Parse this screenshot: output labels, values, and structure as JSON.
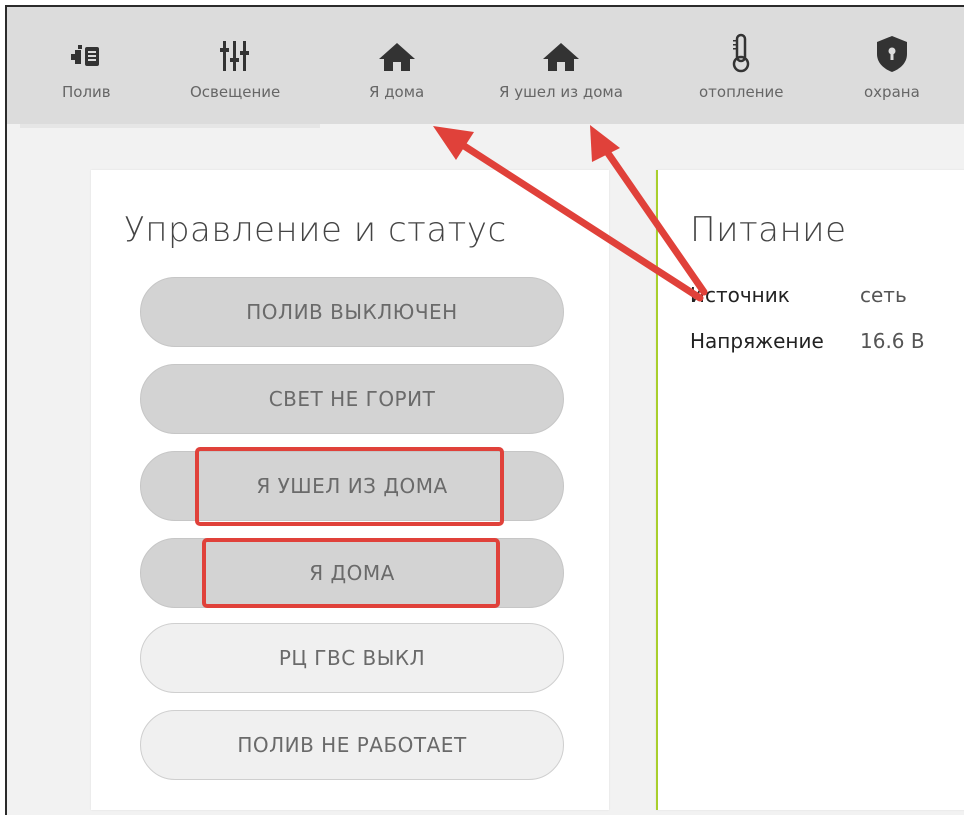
{
  "nav": {
    "items": [
      {
        "label": "Полив",
        "icon": "irrigation-icon"
      },
      {
        "label": "Освещение",
        "icon": "sliders-icon"
      },
      {
        "label": "Я дома",
        "icon": "home-icon"
      },
      {
        "label": "Я ушел из дома",
        "icon": "home-icon"
      },
      {
        "label": "отопление",
        "icon": "thermometer-icon"
      },
      {
        "label": "охрана",
        "icon": "shield-icon"
      }
    ]
  },
  "control": {
    "title": "Управление и статус",
    "buttons": [
      {
        "label": "ПОЛИВ ВЫКЛЮЧЕН"
      },
      {
        "label": "СВЕТ НЕ ГОРИТ"
      },
      {
        "label": "Я УШЕЛ ИЗ ДОМА"
      },
      {
        "label": "Я ДОМА"
      },
      {
        "label": "РЦ ГВС ВЫКЛ"
      },
      {
        "label": "ПОЛИВ НЕ РАБОТАЕТ"
      }
    ]
  },
  "power": {
    "title": "Питание",
    "rows": [
      {
        "label": "Источник",
        "value": "сеть"
      },
      {
        "label": "Напряжение",
        "value": "16.6 В"
      }
    ]
  },
  "colors": {
    "annotation": "#e0413a",
    "accent": "#a9cf2c"
  }
}
